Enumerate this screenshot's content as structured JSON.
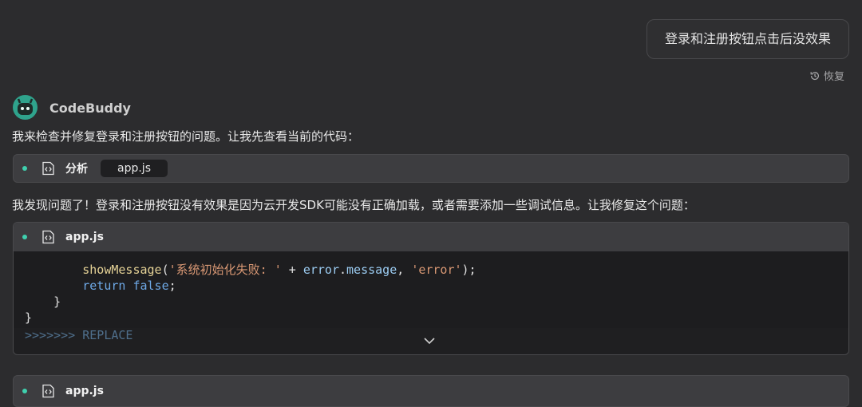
{
  "user_message": "登录和注册按钮点击后没效果",
  "restore_label": "恢复",
  "assistant_name": "CodeBuddy",
  "message1": "我来检查并修复登录和注册按钮的问题。让我先查看当前的代码：",
  "analysis_tool": {
    "label": "分析",
    "file": "app.js"
  },
  "message2": "我发现问题了！登录和注册按钮没有效果是因为云开发SDK可能没有正确加载，或者需要添加一些调试信息。让我修复这个问题：",
  "code_block": {
    "filename": "app.js",
    "line1": {
      "fn": "showMessage",
      "open": "(",
      "str1": "'系统初始化失败: '",
      "plus": " + ",
      "var1": "error",
      "dot": ".",
      "var2": "message",
      "comma": ", ",
      "str2": "'error'",
      "close": ");"
    },
    "line2": {
      "kw": "return",
      "kw2": "false",
      "semi": ";"
    },
    "line3": "}",
    "line4": "}",
    "line5": ">>>>>>> REPLACE"
  },
  "tool3": {
    "label": "app.js"
  },
  "colors": {
    "accent": "#3fd0ae",
    "background": "#2c2c2e"
  },
  "icons": [
    "history-icon",
    "code-file-icon",
    "chevron-down-icon",
    "robot-avatar-icon"
  ]
}
